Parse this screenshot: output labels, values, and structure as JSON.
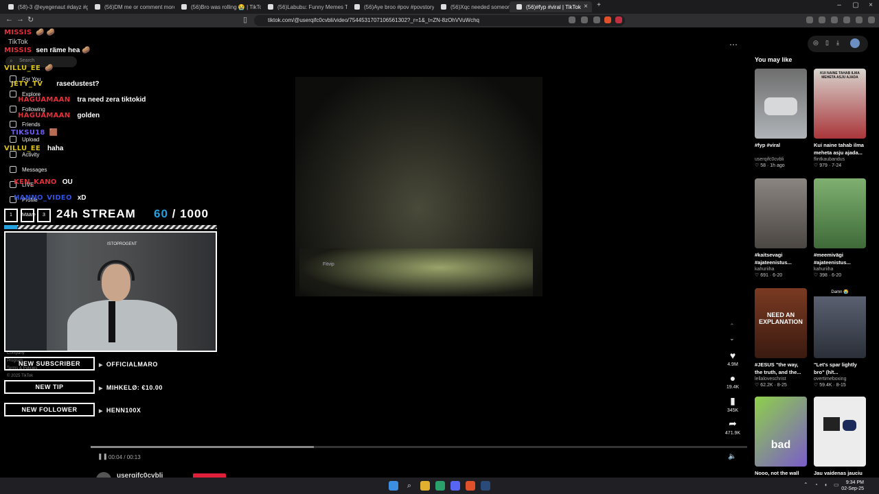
{
  "browser": {
    "tabs": [
      {
        "title": "(58)-3 @eyegenaut #dayz #game #..."
      },
      {
        "title": "(56)DM me or comment more pictur..."
      },
      {
        "title": "(56)Bro was rolling 😭 | TikTok"
      },
      {
        "title": "(56)Labubu: Funny Memes That Will..."
      },
      {
        "title": "(56)Aye broo #pov #povstory #story..."
      },
      {
        "title": "(56)Xqc needed someone to pinch hi..."
      },
      {
        "title": "(56)#fyp #viral | TikTok"
      }
    ],
    "new_tab": "+",
    "url": "tiktok.com/@userqifc0cvbli/video/7544531707106561302?_r=1&_t=ZN-8zOhVVuWchq"
  },
  "tiktok": {
    "logo": "TikTok",
    "search_placeholder": "Search",
    "nav": [
      "For You",
      "Explore",
      "Following",
      "Friends",
      "Upload",
      "Activity",
      "Messages",
      "LIVE",
      "Profile"
    ],
    "footer": [
      "Company",
      "Program",
      "Terms & Policies",
      "© 2025 TikTok"
    ],
    "actions": {
      "likes": "4.9M",
      "comments": "19.4K",
      "saves": "345K",
      "shares": "471.9K"
    },
    "timecode": "00:04 / 00:13",
    "author": "userqifc0cvbli",
    "progress_pct": 34
  },
  "overlay": {
    "chat": [
      {
        "name": "MISSIS",
        "msg": "🥔 🥔",
        "color": "#e0303a"
      },
      {
        "name": "MISSIS",
        "msg": "sen räme hea 🥔",
        "color": "#e0303a"
      },
      {
        "name": "VILLU_EE",
        "msg": "🥔",
        "color": "#d8c21a"
      },
      {
        "name": "JETY_TV",
        "msg": "rasedustest?",
        "color": "#d8c21a"
      },
      {
        "name": "HAGUAMAAN",
        "msg": "tra need zera tiktokid",
        "color": "#e0303a"
      },
      {
        "name": "HAGUAMAAN",
        "msg": "golden",
        "color": "#e0303a"
      },
      {
        "name": "TIKSU18",
        "msg": "🟫",
        "color": "#6a5cf0"
      },
      {
        "name": "VILLU_EE",
        "msg": "haha",
        "color": "#d8c21a"
      },
      {
        "name": "KEN_KANO",
        "msg": "OU",
        "color": "#e0303a"
      },
      {
        "name": "HANNO_VIDEO",
        "msg": "xD",
        "color": "#3050e0"
      }
    ],
    "stream_boxes": [
      "1",
      "Määre",
      "3"
    ],
    "stream_title": "24h STREAM",
    "stream_current": "60",
    "stream_total": "/ 1000",
    "stream_progress": 0.06,
    "webcam_label": "ISTOPROGENT",
    "alerts": [
      {
        "label": "NEW SUBSCRIBER",
        "value": "OFFICIALMARO"
      },
      {
        "label": "NEW TIP",
        "value": "MIHKELØ: €10.00"
      },
      {
        "label": "NEW FOLLOWER",
        "value": "HENN100X"
      }
    ],
    "video_watermark": "Fitvip"
  },
  "suggestions": {
    "title": "You may like",
    "items": [
      {
        "caption": "#fyp #viral",
        "author": "userqifc0cvbli",
        "stats": "♡ 58 · 1h ago",
        "bg": "#9aa0a4"
      },
      {
        "caption": "Kui naine tahab ilma meheta asju ajada...",
        "author": "flintkaubandus",
        "stats": "♡ 979 · 7-24",
        "bg": "#c9c2b8",
        "overlay": "KUI NAINE TAHAB ILMA MEHETA ASJU AJADA"
      },
      {
        "caption": "#kaitsevagi #ajateenistus...",
        "author": "kahuriiha",
        "stats": "♡ 691 · 6-20",
        "bg": "#6d6a66"
      },
      {
        "caption": "#meemivägi #ajateenistus...",
        "author": "kahuriiha",
        "stats": "♡ 398 · 6-20",
        "bg": "#4f7a4a"
      },
      {
        "caption": "#JESUS \"the way, the truth, and the...",
        "author": "lellaloveschrist",
        "stats": "♡ 62.2K · 8-25",
        "bg": "#5a2a1c",
        "overlay": "NEED AN EXPLANATION"
      },
      {
        "caption": "\"Let's spar lightly bro\" (h/t...",
        "author": "overtimeboxing",
        "stats": "♡ 59.4K · 8-15",
        "bg": "#3a4150",
        "overlay": "Damn 😭"
      },
      {
        "caption": "Nooo, not the wall",
        "author": "",
        "stats": "",
        "bg": "#7b5cc9",
        "overlay": "bad"
      },
      {
        "caption": "Jau vaidenas jauciu",
        "author": "",
        "stats": "",
        "bg": "#e8e8e8"
      }
    ]
  },
  "taskbar": {
    "time": "9:34 PM",
    "date": "02-Sep-25"
  }
}
